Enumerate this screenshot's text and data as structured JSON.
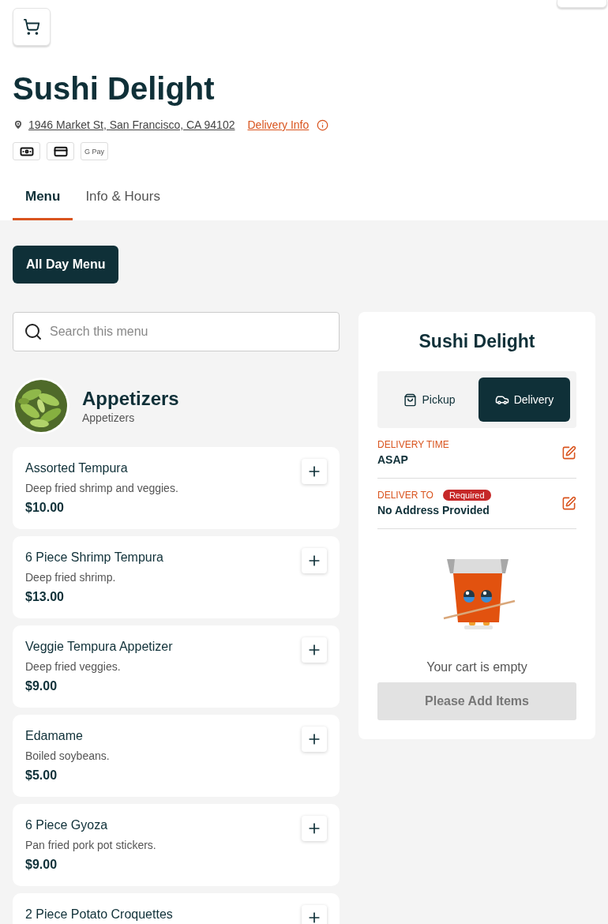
{
  "header": {
    "restaurant_name": "Sushi Delight",
    "address": "1946 Market St, San Francisco, CA 94102",
    "delivery_info_link": "Delivery Info",
    "payment_methods": [
      {
        "kind": "cash"
      },
      {
        "kind": "card"
      },
      {
        "kind": "gpay",
        "label": "G Pay"
      }
    ]
  },
  "tabs": [
    {
      "label": "Menu",
      "selected": true
    },
    {
      "label": "Info & Hours",
      "selected": false
    }
  ],
  "menu_button": "All Day Menu",
  "search": {
    "placeholder": "Search this menu"
  },
  "category": {
    "title": "Appetizers",
    "subtitle": "Appetizers"
  },
  "items": [
    {
      "name": "Assorted Tempura",
      "description": "Deep fried shrimp and veggies.",
      "price": "$10.00"
    },
    {
      "name": "6 Piece Shrimp Tempura",
      "description": "Deep fried shrimp.",
      "price": "$13.00"
    },
    {
      "name": "Veggie Tempura Appetizer",
      "description": "Deep fried veggies.",
      "price": "$9.00"
    },
    {
      "name": "Edamame",
      "description": "Boiled soybeans.",
      "price": "$5.00"
    },
    {
      "name": "6 Piece Gyoza",
      "description": "Pan fried pork pot stickers.",
      "price": "$9.00"
    },
    {
      "name": "2 Piece Potato Croquettes"
    }
  ],
  "cart": {
    "title": "Sushi Delight",
    "modes": [
      {
        "kind": "pickup",
        "label": "Pickup",
        "selected": false
      },
      {
        "kind": "delivery",
        "label": "Delivery",
        "selected": true
      }
    ],
    "fields": [
      {
        "label": "DELIVERY TIME",
        "value": "ASAP"
      },
      {
        "label": "DELIVER TO",
        "badge": "Required",
        "value": "No Address Provided"
      }
    ],
    "empty_message": "Your cart is empty",
    "checkout_button": {
      "label": "Please Add Items",
      "disabled": true
    }
  }
}
